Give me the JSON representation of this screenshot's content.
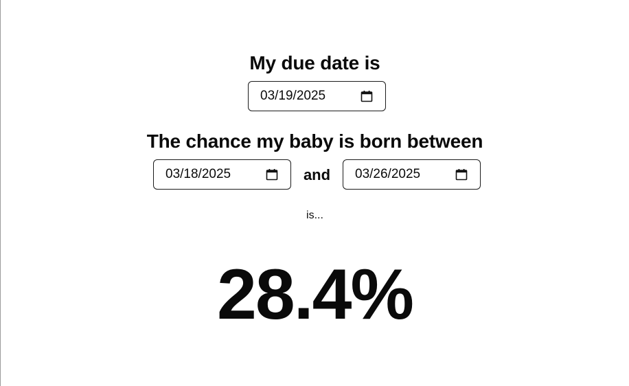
{
  "due_date": {
    "heading": "My due date is",
    "value": "03/19/2025"
  },
  "range": {
    "heading": "The chance my baby is born between",
    "start_value": "03/18/2025",
    "connector": "and",
    "end_value": "03/26/2025"
  },
  "result": {
    "intro": "is...",
    "percentage": "28.4%"
  },
  "icons": {
    "date_picker": "calendar-icon"
  }
}
